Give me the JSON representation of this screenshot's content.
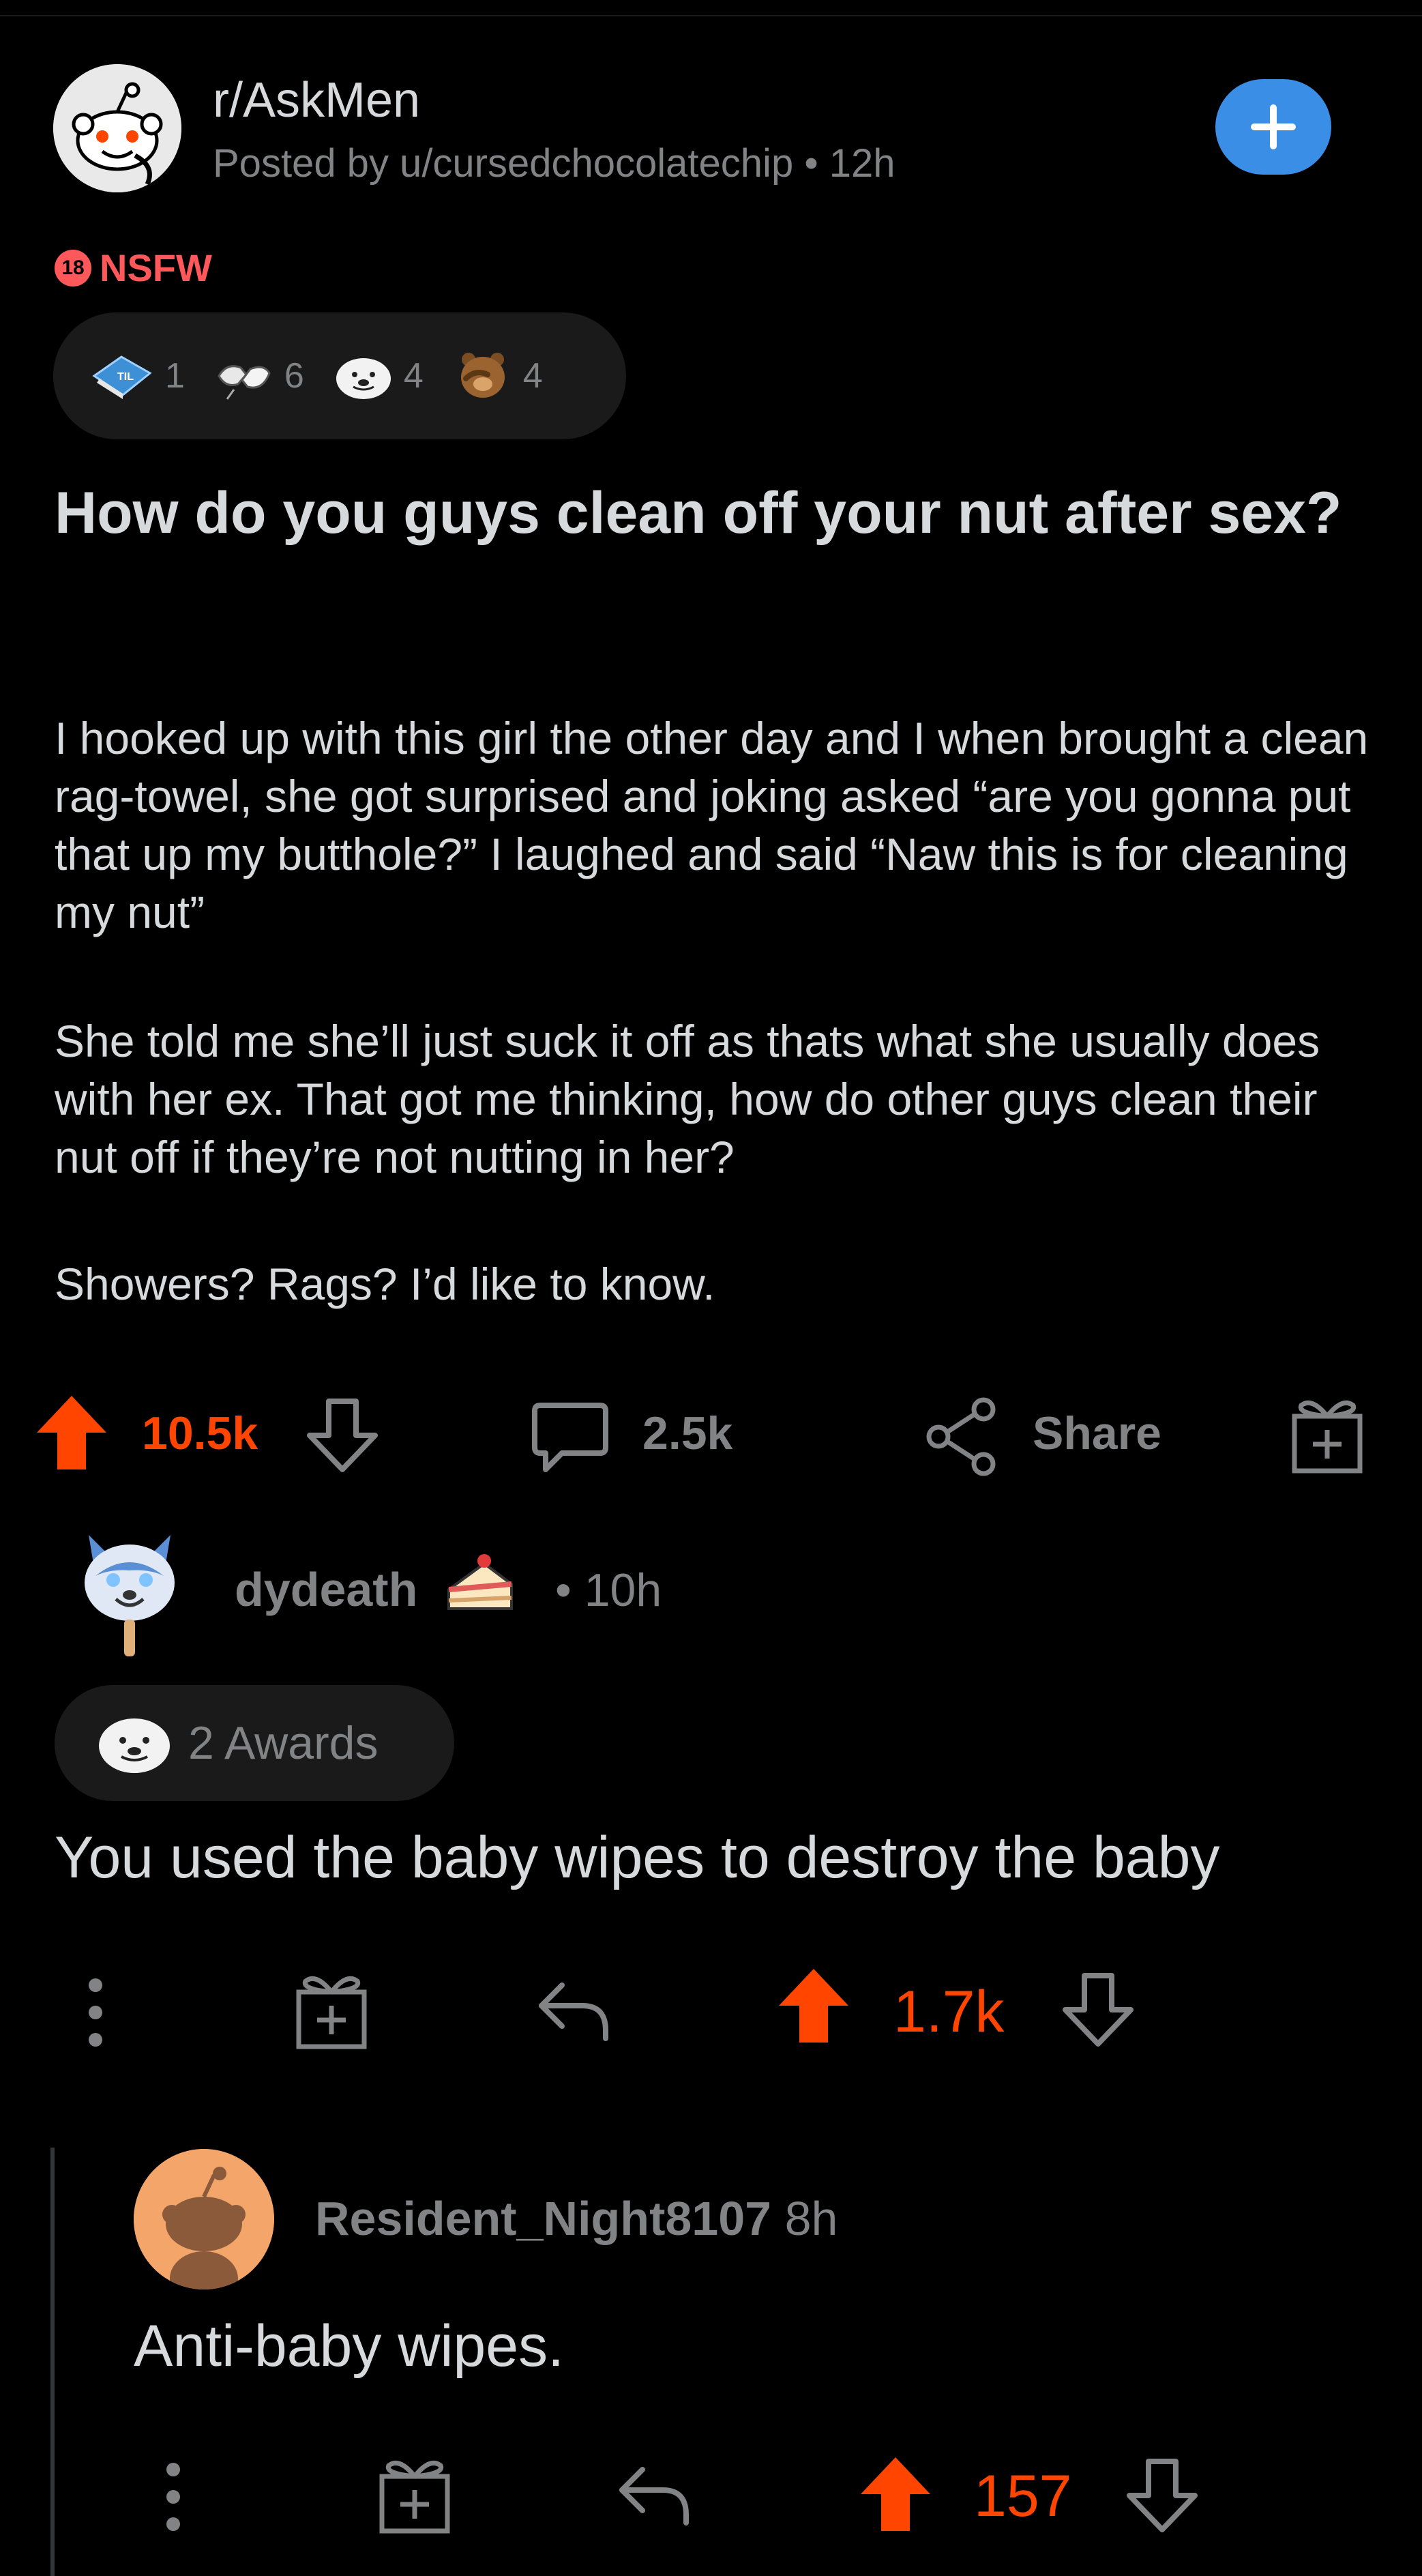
{
  "post": {
    "subreddit": "r/AskMen",
    "posted_by": "Posted by u/cursedchocolatechip",
    "age": "12h",
    "nsfw_badge": "18",
    "nsfw_label": "NSFW",
    "awards": [
      {
        "icon": "til-book-award-icon",
        "count": "1"
      },
      {
        "icon": "fist-bump-award-icon",
        "count": "6"
      },
      {
        "icon": "seal-face-award-icon",
        "count": "4"
      },
      {
        "icon": "bear-facepalm-award-icon",
        "count": "4"
      }
    ],
    "title": "How do you guys clean off your nut after sex?",
    "body": [
      "I hooked up with this girl the other day and I when brought a clean rag-towel, she got surprised and joking asked “are you gonna put that up my butthole?” I laughed and said “Naw this is for cleaning my nut”",
      "She told me she’ll just suck it off as thats what she usually does with her ex. That got me thinking, how do other guys clean their nut off if they’re not nutting in her?",
      "Showers? Rags? I’d like to know."
    ],
    "score": "10.5k",
    "comments": "2.5k",
    "share_label": "Share"
  },
  "comment1": {
    "user": "dydeath",
    "time": "• 10h",
    "awards_label": "2 Awards",
    "text": "You used the baby wipes to destroy the baby",
    "score": "1.7k"
  },
  "comment2": {
    "user": "Resident_Night8107",
    "time": "8h",
    "text": "Anti-baby wipes.",
    "score": "157"
  },
  "colors": {
    "background": "#000000",
    "upvote": "#ff4500",
    "accent_blue": "#3a8ee6",
    "nsfw": "#ff585b",
    "muted": "#818384"
  }
}
